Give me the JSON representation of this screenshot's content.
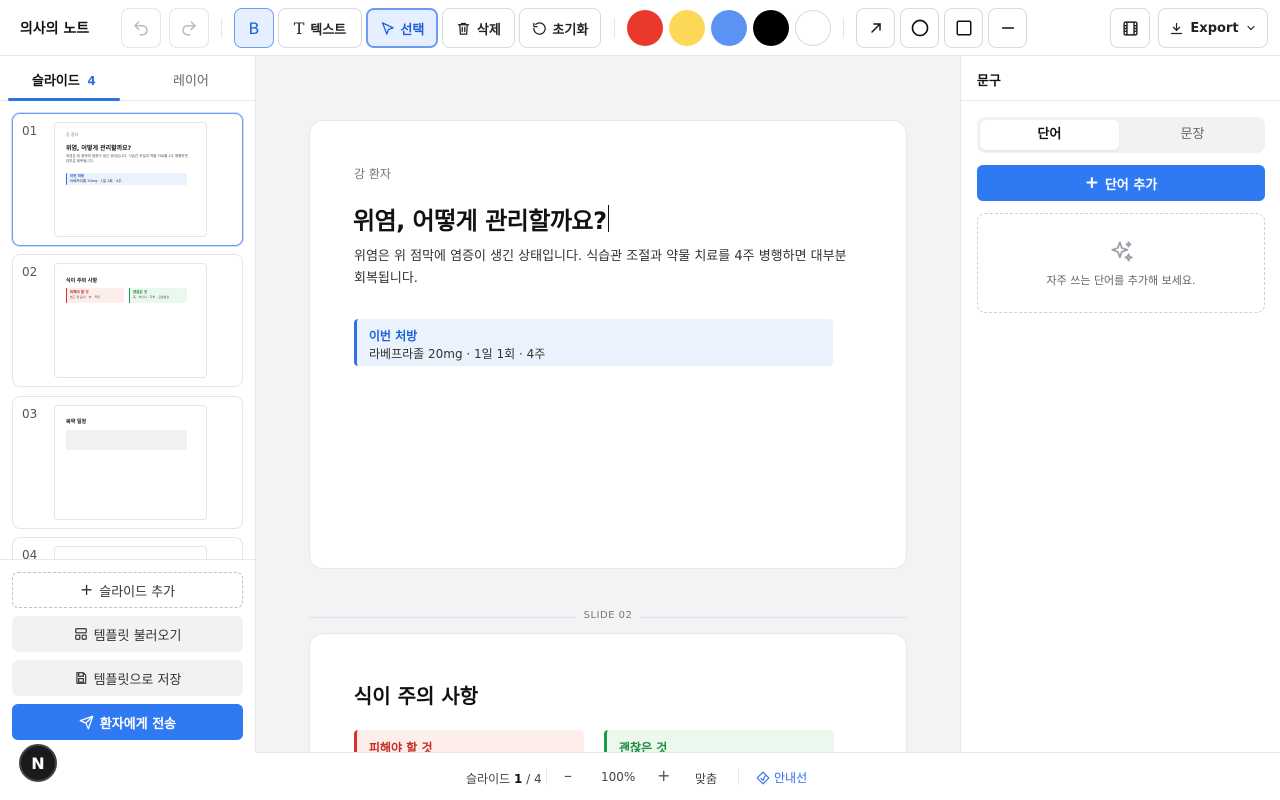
{
  "app": {
    "title": "의사의 노트"
  },
  "toolbar": {
    "bold": "B",
    "text": "텍스트",
    "select": "선택",
    "delete": "삭제",
    "reset": "초기화",
    "export": "Export",
    "colors": [
      "#e8392b",
      "#fcd858",
      "#5b93f5",
      "#000000",
      "#ffffff"
    ]
  },
  "left": {
    "tab_slides": "슬라이드",
    "slide_count": "4",
    "tab_layers": "레이어",
    "thumbs": [
      {
        "num": "01",
        "eyebrow": "강 환자",
        "title": "위염, 어떻게 관리할까요?",
        "body": "위염은 위 점막에 염증이 생긴 상태입니다. 식습관 조절과 약물 치료를 4주 병행하면 대부분 회복됩니다.",
        "box_title": "이번 처방",
        "box_text": "라베프라졸 20mg · 1일 1회 · 4주"
      },
      {
        "num": "02",
        "title": "식이 주의 사항",
        "bad": "피해야 할 것",
        "bad_text": "맵고 짠 음식 · 술 · 커피",
        "good": "괜찮은 것",
        "good_text": "죽 · 바나나 · 두부 · 흰살생선"
      },
      {
        "num": "03",
        "title": "복약 일정"
      },
      {
        "num": "04"
      }
    ],
    "add_slide": "슬라이드 추가",
    "load_template": "템플릿 불러오기",
    "save_template": "템플릿으로 저장",
    "send": "환자에게 전송"
  },
  "slide1": {
    "eyebrow": "강 환자",
    "title": "위염, 어떻게 관리할까요?",
    "body_line1": "위염은 위 점막에 염증이 생긴 상태입니다. 식습관 조절과 약물 치료를 4주 병행하면 대부분",
    "body_line2": "회복됩니다.",
    "rx_title": "이번 처방",
    "rx_text": "라베프라졸 20mg · 1일 1회 · 4주"
  },
  "divider": "SLIDE 02",
  "slide2": {
    "title": "식이 주의 사항",
    "bad_title": "피해야 할 것",
    "good_title": "괜찮은 것"
  },
  "right": {
    "header": "문구",
    "seg_word": "단어",
    "seg_sentence": "문장",
    "add_word": "단어 추가",
    "empty_hint": "자주 쓰는 단어를 추가해 보세요."
  },
  "bottom": {
    "slide_label": "슬라이드",
    "current": "1",
    "total": "/ 4",
    "zoom": "100%",
    "fit": "맞춤",
    "guides": "안내선"
  },
  "avatar": "N"
}
